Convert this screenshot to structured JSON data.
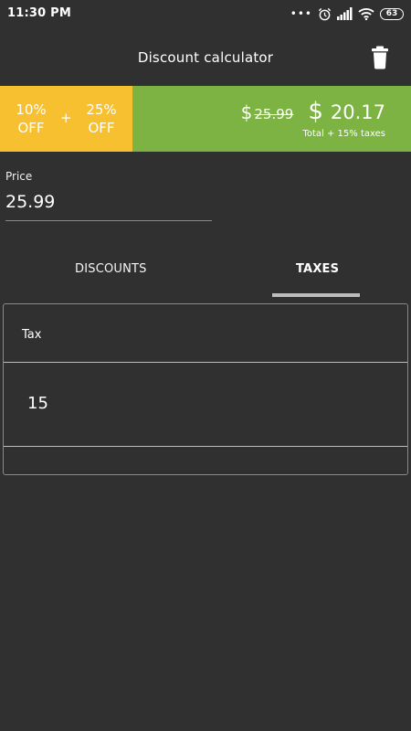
{
  "status_bar": {
    "time": "11:30 PM",
    "dots": "•••",
    "battery": "63",
    "icons": [
      "alarm-icon",
      "signal-icon",
      "wifi-icon",
      "battery-icon"
    ]
  },
  "app_bar": {
    "title": "Discount calculator",
    "action_icon": "trash-icon"
  },
  "summary": {
    "discounts": [
      {
        "amount": "10%",
        "label": "OFF"
      },
      {
        "amount": "25%",
        "label": "OFF"
      }
    ],
    "plus": "+",
    "currency": "$",
    "original_price": "25.99",
    "final_price": "20.17",
    "note": "Total + 15% taxes",
    "colors": {
      "discount_bg": "#F6C030",
      "total_bg": "#7CB342"
    }
  },
  "price": {
    "label": "Price",
    "value": "25.99"
  },
  "tabs": [
    {
      "label": "DISCOUNTS",
      "selected": false
    },
    {
      "label": "TAXES",
      "selected": true
    }
  ],
  "taxes": {
    "header": "Tax",
    "value": "15"
  }
}
